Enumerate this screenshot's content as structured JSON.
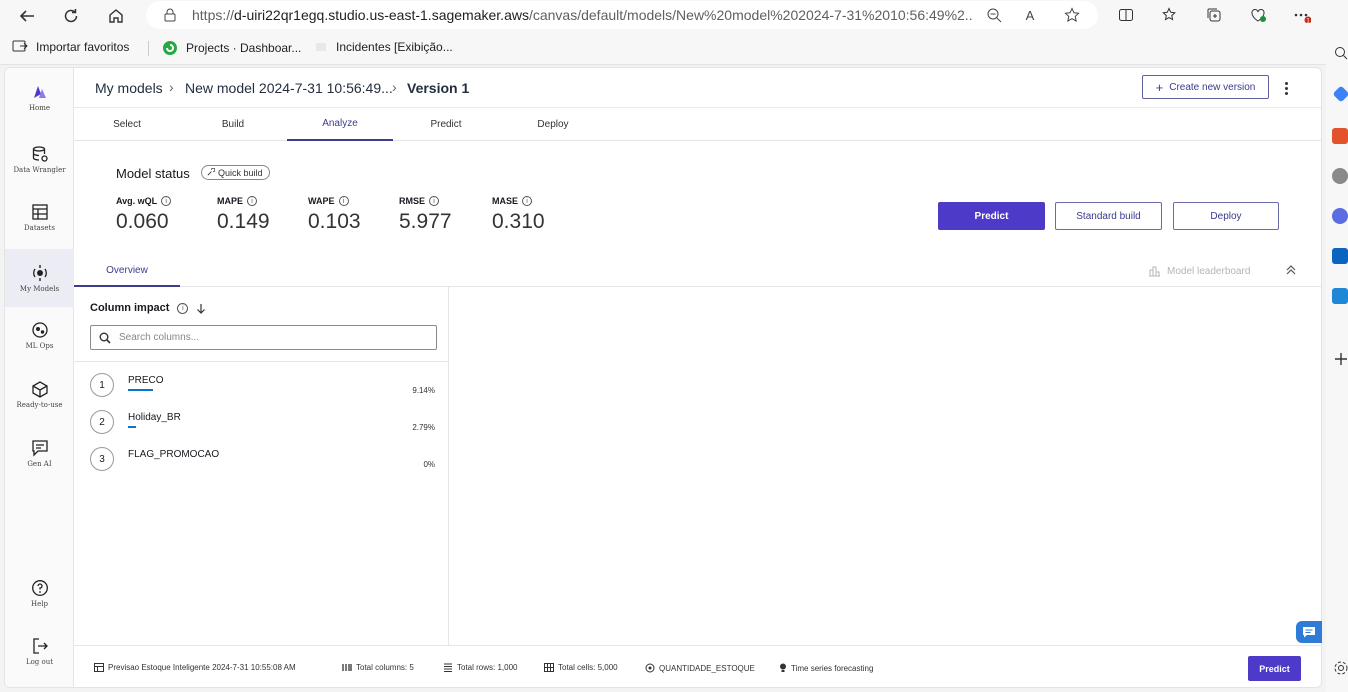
{
  "browser": {
    "url_prefix": "https://",
    "url_host": "d-uiri22qr1egq.studio.us-east-1.sagemaker.aws",
    "url_path": "/canvas/default/models/New%20model%202024-7-31%2010:56:49%2...",
    "read_aloud": "A",
    "notification_count": "1",
    "bookmarks": [
      "Importar favoritos",
      "Projects · Dashboar...",
      "Incidentes [Exibição..."
    ]
  },
  "leftnav": {
    "items": [
      {
        "label": "Home"
      },
      {
        "label": "Data Wrangler"
      },
      {
        "label": "Datasets"
      },
      {
        "label": "My Models"
      },
      {
        "label": "ML Ops"
      },
      {
        "label": "Ready-to-use"
      },
      {
        "label": "Gen AI"
      },
      {
        "label": "Help"
      },
      {
        "label": "Log out"
      }
    ]
  },
  "header": {
    "breadcrumb": [
      "My models",
      "New model 2024-7-31 10:56:49...",
      "Version 1"
    ],
    "create_version": "Create new version"
  },
  "tabs": [
    "Select",
    "Build",
    "Analyze",
    "Predict",
    "Deploy"
  ],
  "active_tab": "Analyze",
  "status": {
    "title": "Model status",
    "badge": "Quick build",
    "metrics": [
      {
        "label": "Avg. wQL",
        "value": "0.060"
      },
      {
        "label": "MAPE",
        "value": "0.149"
      },
      {
        "label": "WAPE",
        "value": "0.103"
      },
      {
        "label": "RMSE",
        "value": "5.977"
      },
      {
        "label": "MASE",
        "value": "0.310"
      }
    ],
    "buttons": {
      "predict": "Predict",
      "standard_build": "Standard build",
      "deploy": "Deploy"
    }
  },
  "subtabs": {
    "overview": "Overview",
    "leaderboard": "Model leaderboard"
  },
  "impact": {
    "title": "Column impact",
    "search_placeholder": "Search columns...",
    "rows": [
      {
        "rank": "1",
        "name": "PRECO",
        "pct": "9.14%",
        "fraction": 0.0914
      },
      {
        "rank": "2",
        "name": "Holiday_BR",
        "pct": "2.79%",
        "fraction": 0.0279
      },
      {
        "rank": "3",
        "name": "FLAG_PROMOCAO",
        "pct": "0%",
        "fraction": 0
      }
    ]
  },
  "footer": {
    "dataset": "Previsao Estoque Inteligente 2024-7-31 10:55:08 AM",
    "columns": "Total columns: 5",
    "rows": "Total rows: 1,000",
    "cells": "Total cells: 5,000",
    "target": "QUANTIDADE_ESTOQUE",
    "type": "Time series forecasting",
    "predict": "Predict"
  },
  "colors": {
    "accent": "#4d3ac8",
    "bar": "#0b76c9"
  }
}
